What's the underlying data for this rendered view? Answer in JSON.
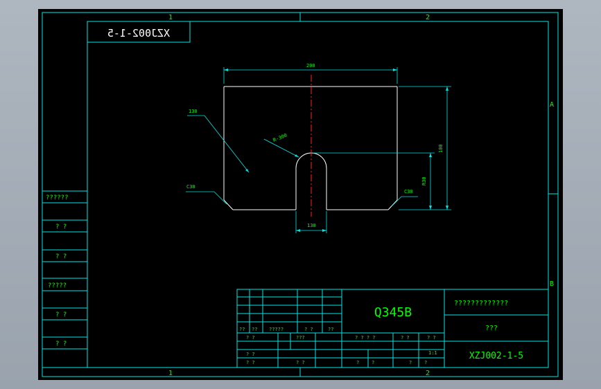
{
  "drawing": {
    "frame_top_zones": [
      "1",
      "2"
    ],
    "frame_bottom_zones": [
      "1",
      "2"
    ],
    "frame_side_zones": [
      "A",
      "B"
    ],
    "mirrored_code": "XZJ002-1-5",
    "side_labels": [
      "??????",
      "? ?",
      "? ?",
      "?????",
      "? ?",
      "? ?"
    ],
    "dimensions": {
      "width": "200",
      "height_total": "100",
      "height_slot": "R30",
      "slot_width": "130",
      "radius": "R-300",
      "leader_top_left": "130",
      "chamfer_left": "C30",
      "chamfer_right": "C30"
    },
    "title_block": {
      "material": "Q345B",
      "company": "?????????????",
      "part_name": "???",
      "drawing_number": "XZJ002-1-5",
      "scale": "1:1",
      "cells": {
        "r1": [
          "??",
          "??",
          "?????",
          "? ?",
          "??"
        ],
        "r2a": "? ?",
        "r2b": "???",
        "r2c": "? ? ? ?",
        "r2d": "? ?",
        "r2e": "? ?",
        "r3a": "? ?",
        "r4a": "? ?",
        "r4b": "? ?",
        "r4c": "?",
        "r4d": "?",
        "r4e": "?",
        "r4f": "?"
      }
    }
  }
}
